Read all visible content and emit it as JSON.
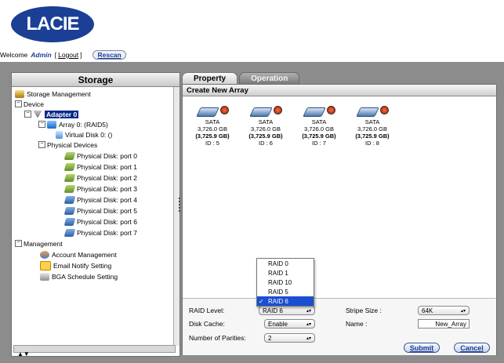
{
  "brand": {
    "logo_text": "LACIE",
    "color": "#1b3f95"
  },
  "header": {
    "welcome_prefix": "Welcome",
    "user": "Admin",
    "logout": "Logout",
    "rescan": "Rescan"
  },
  "left": {
    "title": "Storage",
    "tree": {
      "storage_management": "Storage Management",
      "device": "Device",
      "adapter": "Adapter 0",
      "array": "Array 0: (RAID5)",
      "virtual_disk": "Virtual Disk 0: ()",
      "physical_devices": "Physical Devices",
      "physical_disks": [
        "Physical Disk: port 0",
        "Physical Disk: port 1",
        "Physical Disk: port 2",
        "Physical Disk: port 3",
        "Physical Disk: port 4",
        "Physical Disk: port 5",
        "Physical Disk: port 6",
        "Physical Disk: port 7"
      ],
      "management": "Management",
      "account_management": "Account Management",
      "email_notify": "Email Notify Setting",
      "bga_schedule": "BGA Schedule Setting"
    }
  },
  "tabs": {
    "property": "Property",
    "operation": "Operation"
  },
  "main": {
    "title": "Create New Array",
    "disks": [
      {
        "type": "SATA",
        "size": "3,726.0 GB",
        "capacity": "(3,725.9 GB)",
        "id": "ID : 5"
      },
      {
        "type": "SATA",
        "size": "3,726.0 GB",
        "capacity": "(3,725.9 GB)",
        "id": "ID : 6"
      },
      {
        "type": "SATA",
        "size": "3,726.0 GB",
        "capacity": "(3,725.9 GB)",
        "id": "ID : 7"
      },
      {
        "type": "SATA",
        "size": "3,726.0 GB",
        "capacity": "(3,725.9 GB)",
        "id": "ID : 8"
      }
    ]
  },
  "form": {
    "raid_level_label": "RAID Level:",
    "raid_level_value": "RAID 6",
    "raid_options": [
      "RAID 0",
      "RAID 1",
      "RAID 10",
      "RAID 5",
      "RAID 6"
    ],
    "disk_cache_label": "Disk Cache:",
    "disk_cache_value": "Enable",
    "parities_label": "Number of Parities:",
    "parities_value": "2",
    "stripe_label": "Stripe Size :",
    "stripe_value": "64K",
    "name_label": "Name :",
    "name_value": "New_Array",
    "submit": "Submit",
    "cancel": "Cancel"
  }
}
